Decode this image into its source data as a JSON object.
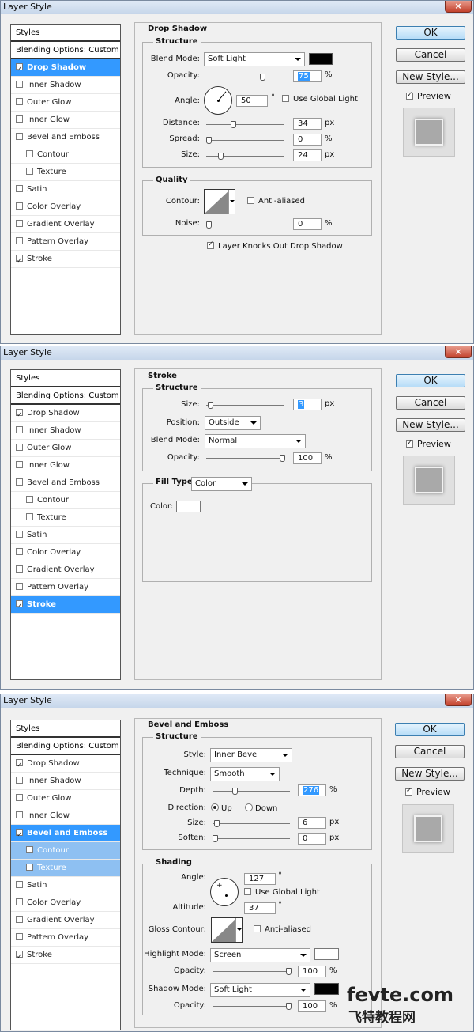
{
  "dialogs": [
    {
      "title": "Layer Style",
      "list": {
        "styles": "Styles",
        "blending": "Blending Options: Custom",
        "items": [
          {
            "label": "Drop Shadow",
            "checked": true,
            "state": "sel"
          },
          {
            "label": "Inner Shadow",
            "checked": false
          },
          {
            "label": "Outer Glow",
            "checked": false
          },
          {
            "label": "Inner Glow",
            "checked": false
          },
          {
            "label": "Bevel and Emboss",
            "checked": false
          },
          {
            "label": "Contour",
            "checked": false,
            "indent": true
          },
          {
            "label": "Texture",
            "checked": false,
            "indent": true
          },
          {
            "label": "Satin",
            "checked": false
          },
          {
            "label": "Color Overlay",
            "checked": false
          },
          {
            "label": "Gradient Overlay",
            "checked": false
          },
          {
            "label": "Pattern Overlay",
            "checked": false
          },
          {
            "label": "Stroke",
            "checked": true
          }
        ]
      },
      "section_title": "Drop Shadow",
      "structure": {
        "legend": "Structure",
        "blend_mode_label": "Blend Mode:",
        "blend_mode": "Soft Light",
        "color": "#000000",
        "opacity_label": "Opacity:",
        "opacity": "75",
        "opacity_unit": "%",
        "opacity_pct": 75,
        "angle_label": "Angle:",
        "angle": "50",
        "angle_unit": "°",
        "angle_deg": 50,
        "global_light": "Use Global Light",
        "global_light_checked": false,
        "distance_label": "Distance:",
        "distance": "34",
        "distance_unit": "px",
        "distance_pct": 34,
        "spread_label": "Spread:",
        "spread": "0",
        "spread_unit": "%",
        "spread_pct": 0,
        "size_label": "Size:",
        "size": "24",
        "size_unit": "px",
        "size_pct": 16
      },
      "quality": {
        "legend": "Quality",
        "contour_label": "Contour:",
        "anti_aliased": "Anti-aliased",
        "anti_aliased_checked": false,
        "noise_label": "Noise:",
        "noise": "0",
        "noise_unit": "%",
        "noise_pct": 0
      },
      "knocks_out": "Layer Knocks Out Drop Shadow",
      "knocks_out_checked": true,
      "buttons": {
        "ok": "OK",
        "cancel": "Cancel",
        "new_style": "New Style...",
        "preview": "Preview",
        "preview_checked": true
      }
    },
    {
      "title": "Layer Style",
      "list": {
        "styles": "Styles",
        "blending": "Blending Options: Custom",
        "items": [
          {
            "label": "Drop Shadow",
            "checked": true
          },
          {
            "label": "Inner Shadow",
            "checked": false
          },
          {
            "label": "Outer Glow",
            "checked": false
          },
          {
            "label": "Inner Glow",
            "checked": false
          },
          {
            "label": "Bevel and Emboss",
            "checked": false
          },
          {
            "label": "Contour",
            "checked": false,
            "indent": true
          },
          {
            "label": "Texture",
            "checked": false,
            "indent": true
          },
          {
            "label": "Satin",
            "checked": false
          },
          {
            "label": "Color Overlay",
            "checked": false
          },
          {
            "label": "Gradient Overlay",
            "checked": false
          },
          {
            "label": "Pattern Overlay",
            "checked": false
          },
          {
            "label": "Stroke",
            "checked": true,
            "state": "sel"
          }
        ]
      },
      "section_title": "Stroke",
      "structure": {
        "legend": "Structure",
        "size_label": "Size:",
        "size": "3",
        "size_unit": "px",
        "size_pct": 2,
        "position_label": "Position:",
        "position": "Outside",
        "blend_mode_label": "Blend Mode:",
        "blend_mode": "Normal",
        "opacity_label": "Opacity:",
        "opacity": "100",
        "opacity_unit": "%",
        "opacity_pct": 100
      },
      "fill": {
        "label": "Fill Type:",
        "type": "Color",
        "color_label": "Color:",
        "color": "#ffffff"
      },
      "buttons": {
        "ok": "OK",
        "cancel": "Cancel",
        "new_style": "New Style...",
        "preview": "Preview",
        "preview_checked": true
      }
    },
    {
      "title": "Layer Style",
      "list": {
        "styles": "Styles",
        "blending": "Blending Options: Custom",
        "items": [
          {
            "label": "Drop Shadow",
            "checked": true
          },
          {
            "label": "Inner Shadow",
            "checked": false
          },
          {
            "label": "Outer Glow",
            "checked": false
          },
          {
            "label": "Inner Glow",
            "checked": false
          },
          {
            "label": "Bevel and Emboss",
            "checked": true,
            "state": "sel"
          },
          {
            "label": "Contour",
            "checked": false,
            "indent": true,
            "state": "sub"
          },
          {
            "label": "Texture",
            "checked": false,
            "indent": true,
            "state": "sub"
          },
          {
            "label": "Satin",
            "checked": false
          },
          {
            "label": "Color Overlay",
            "checked": false
          },
          {
            "label": "Gradient Overlay",
            "checked": false
          },
          {
            "label": "Pattern Overlay",
            "checked": false
          },
          {
            "label": "Stroke",
            "checked": true
          }
        ]
      },
      "section_title": "Bevel and Emboss",
      "structure": {
        "legend": "Structure",
        "style_label": "Style:",
        "style": "Inner Bevel",
        "technique_label": "Technique:",
        "technique": "Smooth",
        "depth_label": "Depth:",
        "depth": "276",
        "depth_unit": "%",
        "depth_pct": 28,
        "direction_label": "Direction:",
        "up": "Up",
        "down": "Down",
        "direction": "Up",
        "size_label": "Size:",
        "size": "6",
        "size_unit": "px",
        "size_pct": 2,
        "soften_label": "Soften:",
        "soften": "0",
        "soften_unit": "px",
        "soften_pct": 0
      },
      "shading": {
        "legend": "Shading",
        "angle_label": "Angle:",
        "angle": "127",
        "angle_unit": "°",
        "global_light": "Use Global Light",
        "global_light_checked": false,
        "altitude_label": "Altitude:",
        "altitude": "37",
        "altitude_unit": "°",
        "gloss_label": "Gloss Contour:",
        "anti_aliased": "Anti-aliased",
        "anti_aliased_checked": false,
        "highlight_label": "Highlight Mode:",
        "highlight_mode": "Screen",
        "highlight_color": "#ffffff",
        "h_opacity_label": "Opacity:",
        "h_opacity": "100",
        "h_opacity_unit": "%",
        "h_opacity_pct": 100,
        "shadow_label": "Shadow Mode:",
        "shadow_mode": "Soft Light",
        "shadow_color": "#000000",
        "s_opacity_label": "Opacity:",
        "s_opacity": "100",
        "s_opacity_unit": "%",
        "s_opacity_pct": 100
      },
      "buttons": {
        "ok": "OK",
        "cancel": "Cancel",
        "new_style": "New Style...",
        "preview": "Preview",
        "preview_checked": true
      }
    }
  ],
  "watermark": {
    "line1": "fevte.com",
    "line2": "飞特教程网"
  },
  "close_icon": "×",
  "colors": {
    "selection": "#3399ff",
    "selection_sub": "#8ec0f2"
  }
}
